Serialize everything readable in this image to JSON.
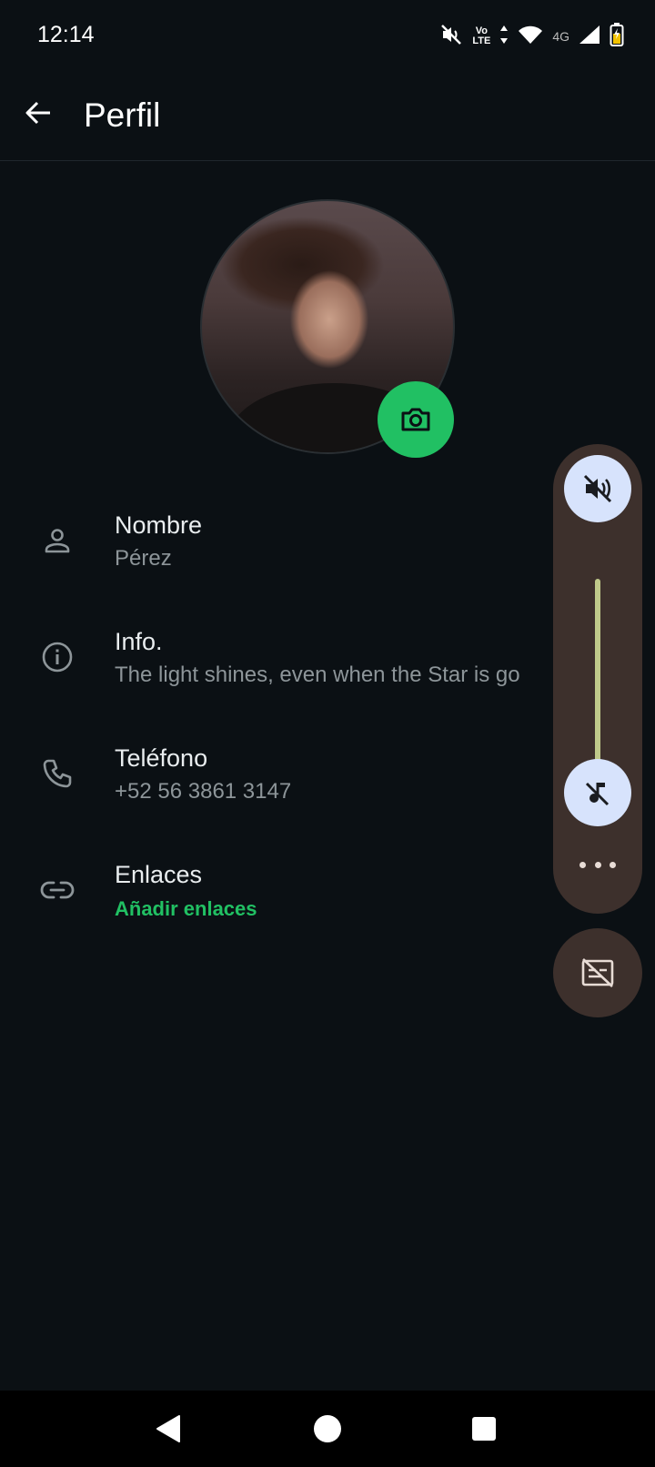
{
  "status_bar": {
    "time": "12:14",
    "volte_top": "Vo",
    "volte_bottom": "LTE",
    "network": "4G",
    "icons": [
      "vibrate-off-icon",
      "volte-icon",
      "data-arrows-icon",
      "wifi-icon",
      "signal-icon",
      "battery-charging-icon"
    ]
  },
  "app_bar": {
    "title": "Perfil",
    "back_icon": "arrow-left-icon"
  },
  "profile": {
    "photo_icon": "camera-icon",
    "accent": "#21c063"
  },
  "rows": [
    {
      "icon": "person-icon",
      "label": "Nombre",
      "value": "Pérez"
    },
    {
      "icon": "info-icon",
      "label": "Info.",
      "value": "The light shines, even when the Star is go"
    },
    {
      "icon": "phone-icon",
      "label": "Teléfono",
      "value": "+52 56 3861 3147"
    },
    {
      "icon": "link-icon",
      "label": "Enlaces",
      "value": "Añadir enlaces"
    }
  ],
  "volume_panel": {
    "mute_icon": "speaker-mute-icon",
    "level_fraction": 0,
    "ringer_icon": "music-off-icon",
    "more_icon": "more-horizontal-icon",
    "captions_icon": "captions-off-icon",
    "panel_color": "#3d302c"
  },
  "nav_bar": {
    "buttons": [
      "back-triangle-icon",
      "home-circle-icon",
      "recents-square-icon"
    ]
  }
}
